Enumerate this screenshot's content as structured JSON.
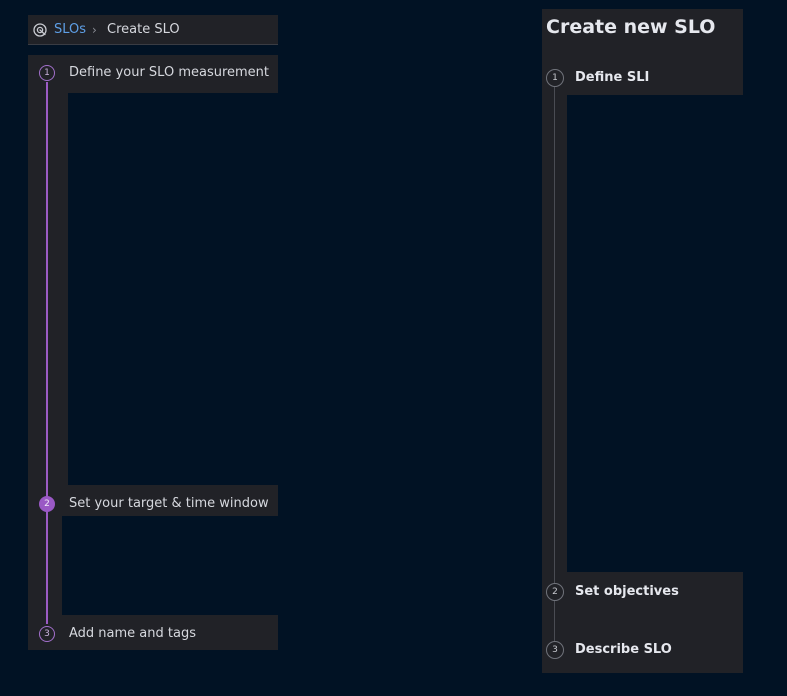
{
  "left_wizard": {
    "breadcrumb": {
      "icon": "slo-target-icon",
      "parent_label": "SLOs",
      "separator": "›",
      "current_label": "Create SLO"
    },
    "steps": [
      {
        "number": "1",
        "label": "Define your SLO measurement",
        "state": "upcoming"
      },
      {
        "number": "2",
        "label": "Set your target & time window",
        "state": "current"
      },
      {
        "number": "3",
        "label": "Add name and tags",
        "state": "upcoming"
      }
    ],
    "accent_color": "#9b5bc4",
    "link_color": "#5e9fe6"
  },
  "right_wizard": {
    "title": "Create new SLO",
    "steps": [
      {
        "number": "1",
        "label": "Define SLI"
      },
      {
        "number": "2",
        "label": "Set objectives"
      },
      {
        "number": "3",
        "label": "Describe SLO"
      }
    ]
  },
  "colors": {
    "background": "#011224",
    "panel": "#212227"
  }
}
